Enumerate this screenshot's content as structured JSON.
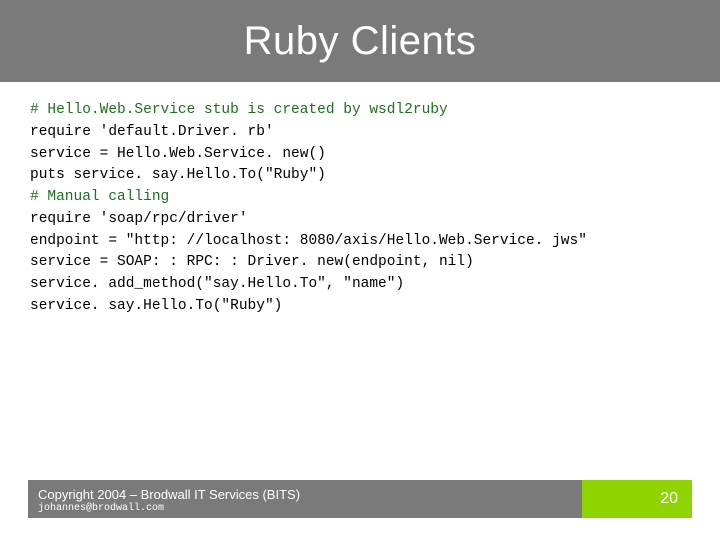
{
  "title": "Ruby Clients",
  "code": {
    "l1": "# Hello.Web.Service stub is created by wsdl2ruby",
    "l2": "require 'default.Driver. rb'",
    "l3": "",
    "l4": "service = Hello.Web.Service. new()",
    "l5": "puts service. say.Hello.To(\"Ruby\")",
    "l6": "",
    "l7": "",
    "l8": "# Manual calling",
    "l9": "require 'soap/rpc/driver'",
    "l10": "",
    "l11": "endpoint = \"http: //localhost: 8080/axis/Hello.Web.Service. jws\"",
    "l12": "service = SOAP: : RPC: : Driver. new(endpoint, nil)",
    "l13": "service. add_method(\"say.Hello.To\", \"name\")",
    "l14": "service. say.Hello.To(\"Ruby\")"
  },
  "footer": {
    "copyright": "Copyright 2004 – Brodwall IT Services (BITS)",
    "email": "johannes@brodwall.com",
    "page": "20"
  }
}
